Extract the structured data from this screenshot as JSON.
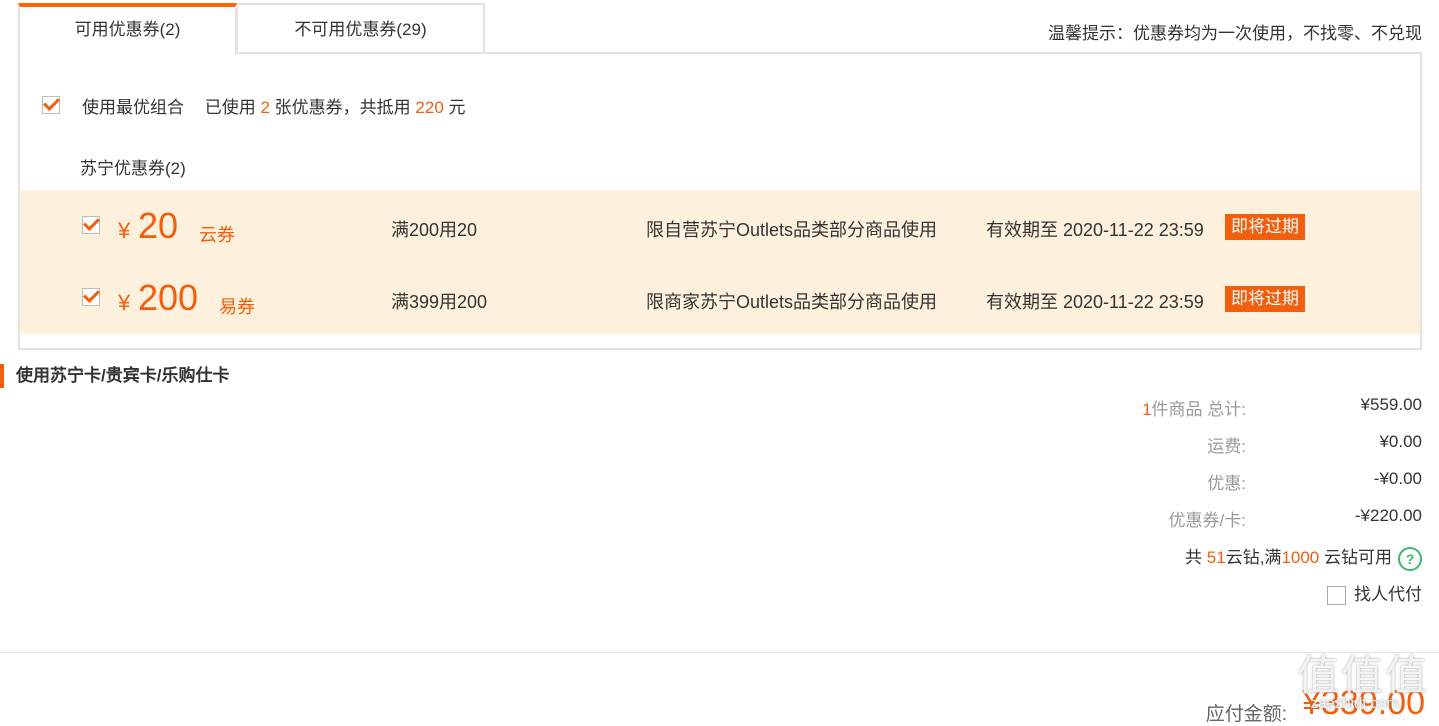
{
  "tabs": {
    "available": "可用优惠券(2)",
    "unavailable": "不可用优惠券(29)"
  },
  "tip": "温馨提示：优惠券均为一次使用，不找零、不兑现",
  "best_combo": {
    "label": "使用最优组合",
    "used_prefix": "已使用",
    "used_count": "2",
    "used_mid": "张优惠券，共抵用",
    "used_amount": "220",
    "used_suffix": "元",
    "checked": true
  },
  "group_title": "苏宁优惠券(2)",
  "coupons": [
    {
      "yen": "¥",
      "amount": "20",
      "type": "云券",
      "rule": "满200用20",
      "scope": "限自营苏宁Outlets品类部分商品使用",
      "expiry": "有效期至 2020-11-22 23:59",
      "badge": "即将过期",
      "checked": true
    },
    {
      "yen": "¥",
      "amount": "200",
      "type": "易券",
      "rule": "满399用200",
      "scope": "限商家苏宁Outlets品类部分商品使用",
      "expiry": "有效期至 2020-11-22 23:59",
      "badge": "即将过期",
      "checked": true
    }
  ],
  "card_section_title": "使用苏宁卡/贵宾卡/乐购仕卡",
  "summary": {
    "items_count": "1",
    "items_label": "件商品 总计:",
    "items_total": "¥559.00",
    "shipping_label": "运费:",
    "shipping": "¥0.00",
    "discount_label": "优惠:",
    "discount": "-¥0.00",
    "coupon_label": "优惠券/卡:",
    "coupon": "-¥220.00"
  },
  "diamond": {
    "prefix": "共",
    "count": "51",
    "mid": "云钻,满",
    "threshold": "1000",
    "suffix": "云钻可用"
  },
  "proxy_pay": {
    "label": "找人代付",
    "checked": false
  },
  "payable": {
    "label": "应付金额:",
    "amount": "¥339.00"
  },
  "watermark": {
    "glyphs": "值值值",
    "site": "zaezhidt.com"
  },
  "colors": {
    "accent": "#f25e0c",
    "row_bg": "#fdf1dd",
    "help_green": "#3cb86a"
  }
}
